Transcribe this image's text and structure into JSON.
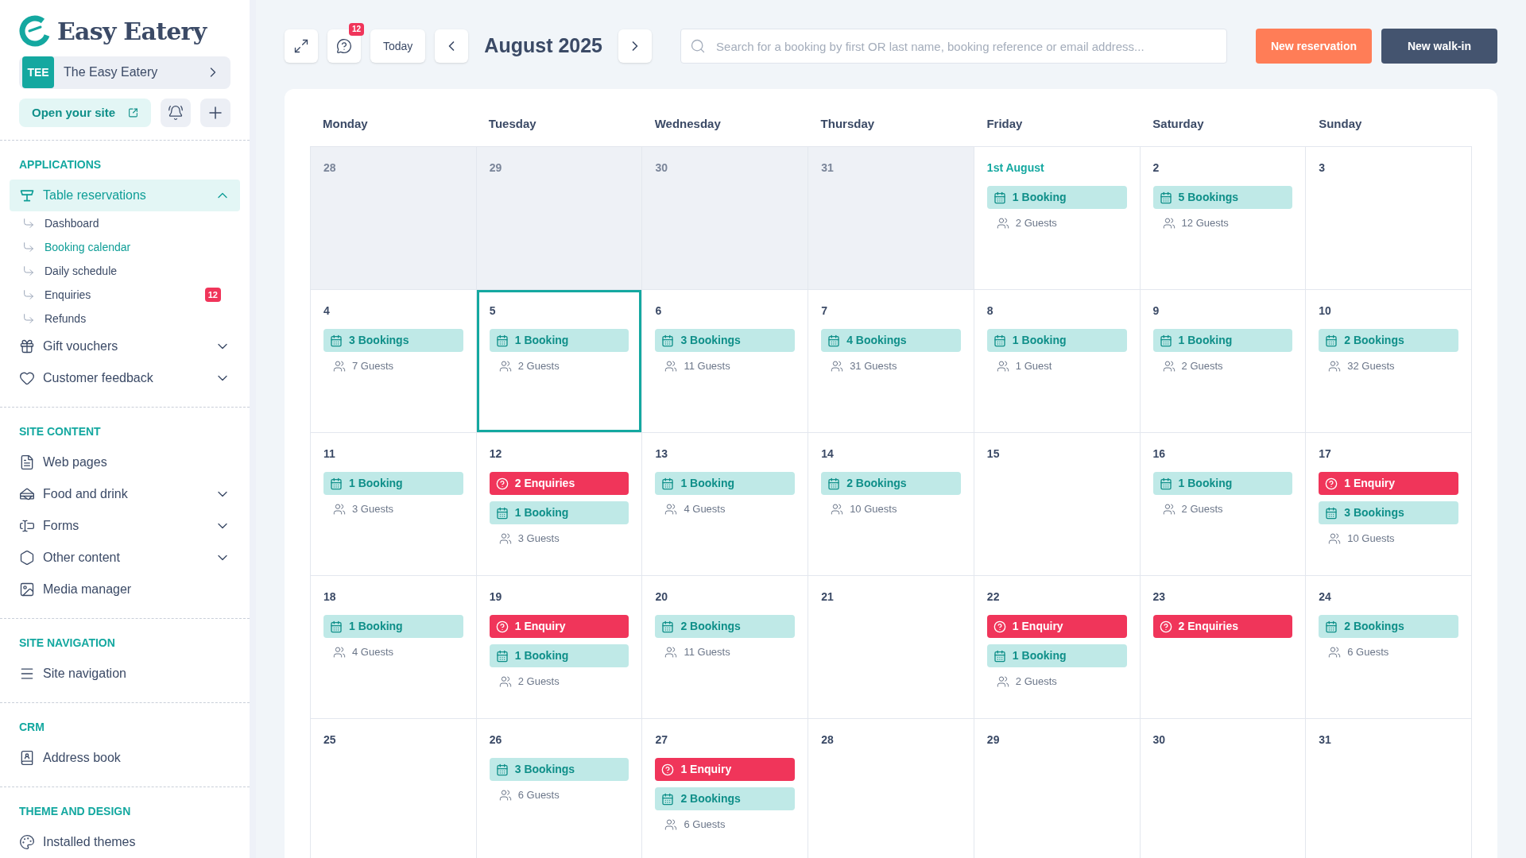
{
  "sidebar": {
    "logo_text": "Easy Eatery",
    "site": {
      "initials": "TEE",
      "name": "The Easy Eatery"
    },
    "open_site": "Open your site",
    "sections": [
      {
        "title": "APPLICATIONS",
        "items": [
          {
            "kind": "group",
            "label": "Table reservations",
            "selected": true,
            "expanded": true,
            "children": [
              {
                "label": "Dashboard",
                "selected": false
              },
              {
                "label": "Booking calendar",
                "selected": true
              },
              {
                "label": "Daily schedule",
                "selected": false
              },
              {
                "label": "Enquiries",
                "selected": false,
                "badge": "12"
              },
              {
                "label": "Refunds",
                "selected": false
              }
            ]
          },
          {
            "kind": "group",
            "label": "Gift vouchers",
            "selected": false,
            "expanded": false
          },
          {
            "kind": "group",
            "label": "Customer feedback",
            "selected": false,
            "expanded": false
          }
        ]
      },
      {
        "title": "SITE CONTENT",
        "items": [
          {
            "kind": "link",
            "label": "Web pages",
            "selected": false
          },
          {
            "kind": "group",
            "label": "Food and drink",
            "selected": false,
            "expanded": false
          },
          {
            "kind": "group",
            "label": "Forms",
            "selected": false,
            "expanded": false
          },
          {
            "kind": "group",
            "label": "Other content",
            "selected": false,
            "expanded": false
          },
          {
            "kind": "link",
            "label": "Media manager",
            "selected": false
          }
        ]
      },
      {
        "title": "SITE NAVIGATION",
        "items": [
          {
            "kind": "link",
            "label": "Site navigation",
            "selected": false
          }
        ]
      },
      {
        "title": "CRM",
        "items": [
          {
            "kind": "link",
            "label": "Address book",
            "selected": false
          }
        ]
      },
      {
        "title": "THEME AND DESIGN",
        "items": [
          {
            "kind": "link",
            "label": "Installed themes",
            "selected": false
          }
        ]
      }
    ]
  },
  "toolbar": {
    "notification_count": "12",
    "today": "Today",
    "month": "August 2025",
    "search_placeholder": "Search for a booking by first OR last name, booking reference or email address...",
    "new_reservation": "New reservation",
    "new_walk_in": "New walk-in"
  },
  "calendar": {
    "weekdays": [
      "Monday",
      "Tuesday",
      "Wednesday",
      "Thursday",
      "Friday",
      "Saturday",
      "Sunday"
    ],
    "days": [
      {
        "label": "28",
        "outside": true,
        "first": false,
        "selected": false
      },
      {
        "label": "29",
        "outside": true,
        "first": false,
        "selected": false
      },
      {
        "label": "30",
        "outside": true,
        "first": false,
        "selected": false
      },
      {
        "label": "31",
        "outside": true,
        "first": false,
        "selected": false
      },
      {
        "label": "1st August",
        "outside": false,
        "first": true,
        "selected": false,
        "events": [
          {
            "kind": "booking",
            "label": "1 Booking"
          }
        ],
        "guests": "2 Guests"
      },
      {
        "label": "2",
        "outside": false,
        "first": false,
        "selected": false,
        "events": [
          {
            "kind": "booking",
            "label": "5 Bookings"
          }
        ],
        "guests": "12 Guests"
      },
      {
        "label": "3",
        "outside": false,
        "first": false,
        "selected": false
      },
      {
        "label": "4",
        "outside": false,
        "first": false,
        "selected": false,
        "events": [
          {
            "kind": "booking",
            "label": "3 Bookings"
          }
        ],
        "guests": "7 Guests"
      },
      {
        "label": "5",
        "outside": false,
        "first": false,
        "selected": true,
        "events": [
          {
            "kind": "booking",
            "label": "1 Booking"
          }
        ],
        "guests": "2 Guests"
      },
      {
        "label": "6",
        "outside": false,
        "first": false,
        "selected": false,
        "events": [
          {
            "kind": "booking",
            "label": "3 Bookings"
          }
        ],
        "guests": "11 Guests"
      },
      {
        "label": "7",
        "outside": false,
        "first": false,
        "selected": false,
        "events": [
          {
            "kind": "booking",
            "label": "4 Bookings"
          }
        ],
        "guests": "31 Guests"
      },
      {
        "label": "8",
        "outside": false,
        "first": false,
        "selected": false,
        "events": [
          {
            "kind": "booking",
            "label": "1 Booking"
          }
        ],
        "guests": "1 Guest"
      },
      {
        "label": "9",
        "outside": false,
        "first": false,
        "selected": false,
        "events": [
          {
            "kind": "booking",
            "label": "1 Booking"
          }
        ],
        "guests": "2 Guests"
      },
      {
        "label": "10",
        "outside": false,
        "first": false,
        "selected": false,
        "events": [
          {
            "kind": "booking",
            "label": "2 Bookings"
          }
        ],
        "guests": "32 Guests"
      },
      {
        "label": "11",
        "outside": false,
        "first": false,
        "selected": false,
        "events": [
          {
            "kind": "booking",
            "label": "1 Booking"
          }
        ],
        "guests": "3 Guests"
      },
      {
        "label": "12",
        "outside": false,
        "first": false,
        "selected": false,
        "events": [
          {
            "kind": "enquiry",
            "label": "2 Enquiries"
          },
          {
            "kind": "booking",
            "label": "1 Booking"
          }
        ],
        "guests": "3 Guests"
      },
      {
        "label": "13",
        "outside": false,
        "first": false,
        "selected": false,
        "events": [
          {
            "kind": "booking",
            "label": "1 Booking"
          }
        ],
        "guests": "4 Guests"
      },
      {
        "label": "14",
        "outside": false,
        "first": false,
        "selected": false,
        "events": [
          {
            "kind": "booking",
            "label": "2 Bookings"
          }
        ],
        "guests": "10 Guests"
      },
      {
        "label": "15",
        "outside": false,
        "first": false,
        "selected": false
      },
      {
        "label": "16",
        "outside": false,
        "first": false,
        "selected": false,
        "events": [
          {
            "kind": "booking",
            "label": "1 Booking"
          }
        ],
        "guests": "2 Guests"
      },
      {
        "label": "17",
        "outside": false,
        "first": false,
        "selected": false,
        "events": [
          {
            "kind": "enquiry",
            "label": "1 Enquiry"
          },
          {
            "kind": "booking",
            "label": "3 Bookings"
          }
        ],
        "guests": "10 Guests"
      },
      {
        "label": "18",
        "outside": false,
        "first": false,
        "selected": false,
        "events": [
          {
            "kind": "booking",
            "label": "1 Booking"
          }
        ],
        "guests": "4 Guests"
      },
      {
        "label": "19",
        "outside": false,
        "first": false,
        "selected": false,
        "events": [
          {
            "kind": "enquiry",
            "label": "1 Enquiry"
          },
          {
            "kind": "booking",
            "label": "1 Booking"
          }
        ],
        "guests": "2 Guests"
      },
      {
        "label": "20",
        "outside": false,
        "first": false,
        "selected": false,
        "events": [
          {
            "kind": "booking",
            "label": "2 Bookings"
          }
        ],
        "guests": "11 Guests"
      },
      {
        "label": "21",
        "outside": false,
        "first": false,
        "selected": false
      },
      {
        "label": "22",
        "outside": false,
        "first": false,
        "selected": false,
        "events": [
          {
            "kind": "enquiry",
            "label": "1 Enquiry"
          },
          {
            "kind": "booking",
            "label": "1 Booking"
          }
        ],
        "guests": "2 Guests"
      },
      {
        "label": "23",
        "outside": false,
        "first": false,
        "selected": false,
        "events": [
          {
            "kind": "enquiry",
            "label": "2 Enquiries"
          }
        ]
      },
      {
        "label": "24",
        "outside": false,
        "first": false,
        "selected": false,
        "events": [
          {
            "kind": "booking",
            "label": "2 Bookings"
          }
        ],
        "guests": "6 Guests"
      },
      {
        "label": "25",
        "outside": false,
        "first": false,
        "selected": false
      },
      {
        "label": "26",
        "outside": false,
        "first": false,
        "selected": false,
        "events": [
          {
            "kind": "booking",
            "label": "3 Bookings"
          }
        ],
        "guests": "6 Guests"
      },
      {
        "label": "27",
        "outside": false,
        "first": false,
        "selected": false,
        "events": [
          {
            "kind": "enquiry",
            "label": "1 Enquiry"
          },
          {
            "kind": "booking",
            "label": "2 Bookings"
          }
        ],
        "guests": "6 Guests"
      },
      {
        "label": "28",
        "outside": false,
        "first": false,
        "selected": false
      },
      {
        "label": "29",
        "outside": false,
        "first": false,
        "selected": false
      },
      {
        "label": "30",
        "outside": false,
        "first": false,
        "selected": false
      },
      {
        "label": "31",
        "outside": false,
        "first": false,
        "selected": false
      }
    ]
  }
}
